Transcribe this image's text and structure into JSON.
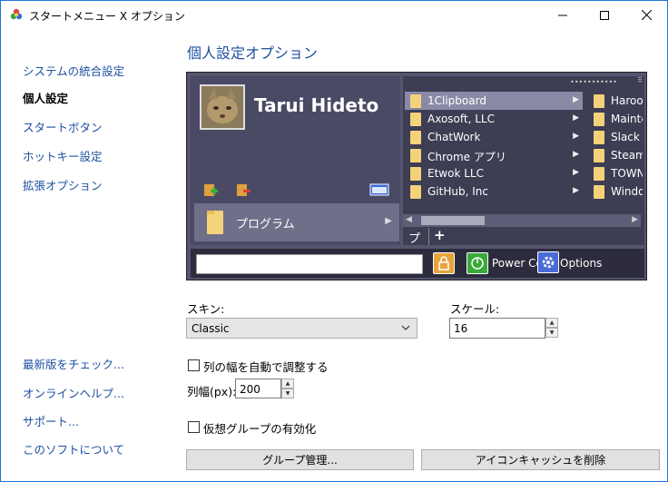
{
  "window": {
    "title": "スタートメニュー X オプション",
    "minimize_icon": "minimize-icon",
    "maximize_icon": "maximize-icon",
    "close_icon": "close-icon"
  },
  "sidebar": {
    "items": [
      {
        "label": "システムの統合設定",
        "active": false
      },
      {
        "label": "個人設定",
        "active": true
      },
      {
        "label": "スタートボタン",
        "active": false
      },
      {
        "label": "ホットキー設定",
        "active": false
      },
      {
        "label": "拡張オプション",
        "active": false
      }
    ],
    "bottom_links": [
      {
        "label": "最新版をチェック..."
      },
      {
        "label": "オンラインヘルプ..."
      },
      {
        "label": "サポート..."
      },
      {
        "label": "このソフトについて"
      }
    ]
  },
  "main": {
    "section_title": "個人設定オプション"
  },
  "preview": {
    "username": "Tarui Hideto",
    "programs_label": "プログラム",
    "menu_items_col1": [
      {
        "label": "1Clipboard",
        "selected": true
      },
      {
        "label": "Axosoft, LLC",
        "selected": false
      },
      {
        "label": "ChatWork",
        "selected": false
      },
      {
        "label": "Chrome アプリ",
        "selected": false
      },
      {
        "label": "Etwok LLC",
        "selected": false
      },
      {
        "label": "GitHub, Inc",
        "selected": false
      }
    ],
    "menu_items_col2": [
      {
        "label": "Haroo"
      },
      {
        "label": "Mainte"
      },
      {
        "label": "Slack T"
      },
      {
        "label": "Steam"
      },
      {
        "label": "TOWN"
      },
      {
        "label": "Windo"
      }
    ],
    "tab_label": "プ",
    "add_tab": "+",
    "power_label_a": "Power Co",
    "power_label_b": "Options",
    "colors": {
      "panel_bg": "#55556e",
      "selected_item": "#8a8aa6",
      "folder": "#f4d27a"
    }
  },
  "settings": {
    "skin_label": "スキン:",
    "skin_value": "Classic",
    "scale_label": "スケール:",
    "scale_value": "16",
    "auto_width_label": "列の幅を自動で調整する",
    "auto_width_checked": false,
    "col_width_label": "列幅(px):",
    "col_width_value": "200",
    "virtual_group_label": "仮想グループの有効化",
    "virtual_group_checked": false,
    "group_manage_button": "グループ管理...",
    "clear_icon_cache_button": "アイコンキャッシュを削除"
  }
}
